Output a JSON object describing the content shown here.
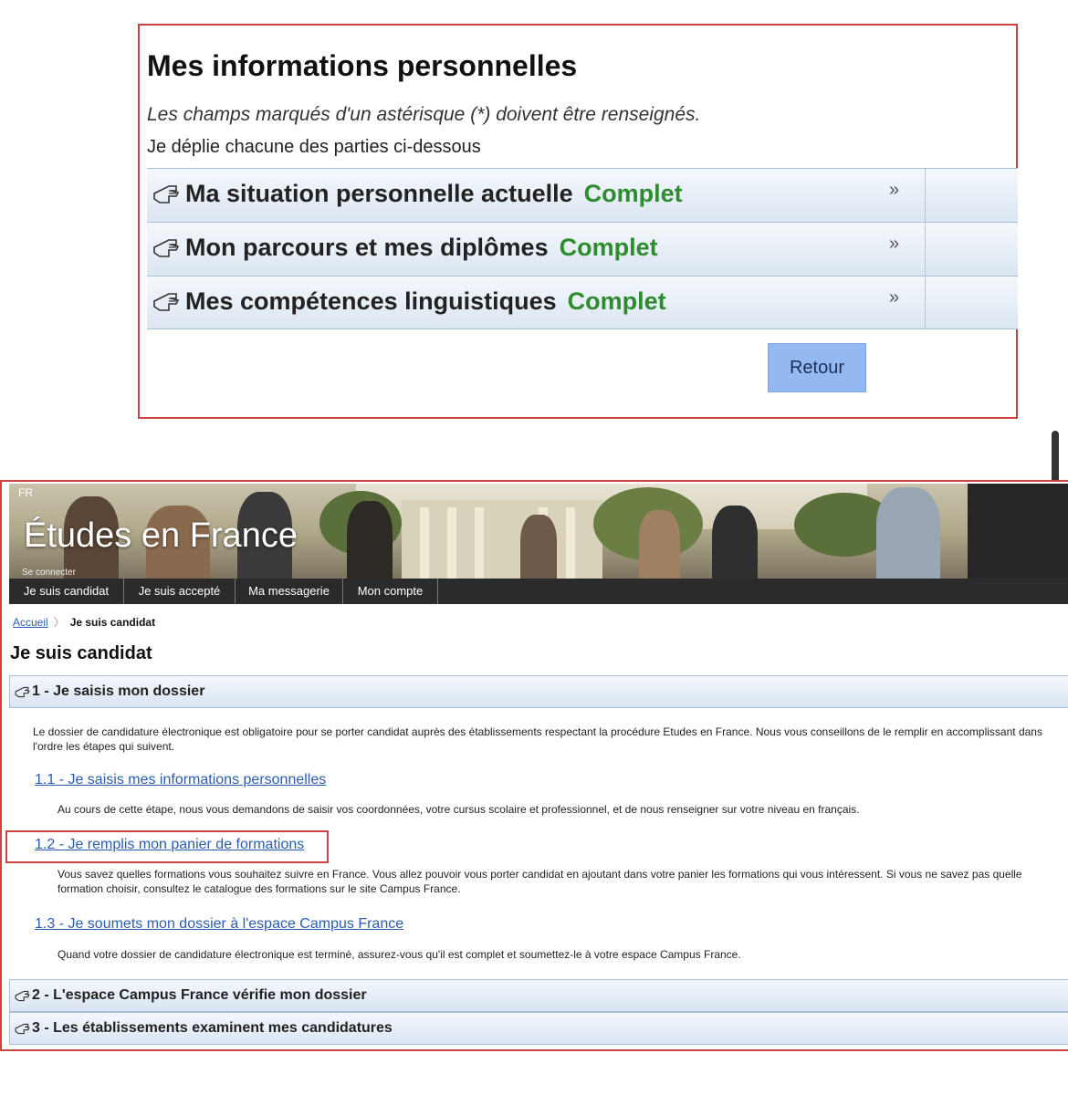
{
  "top_panel": {
    "title": "Mes informations personnelles",
    "note": "Les champs marqués d'un astérisque (*) doivent être renseignés.",
    "instruction": "Je déplie chacune des parties ci-dessous",
    "sections": [
      {
        "label": "Ma situation personnelle actuelle",
        "status": "Complet",
        "chevron": "»"
      },
      {
        "label": "Mon parcours et mes diplômes",
        "status": "Complet",
        "chevron": "»"
      },
      {
        "label": "Mes compétences linguistiques",
        "status": "Complet",
        "chevron": "»"
      }
    ],
    "retour_label": "Retour"
  },
  "site": {
    "lang": "FR",
    "title": "Études en France",
    "banner_sub": "Se connecter"
  },
  "nav": {
    "items": [
      "Je suis candidat",
      "Je suis accepté",
      "Ma messagerie",
      "Mon compte"
    ]
  },
  "breadcrumb": {
    "home": "Accueil",
    "separator": "〉",
    "current": "Je suis candidat"
  },
  "page": {
    "title": "Je suis candidat",
    "step1": {
      "label": "1 - Je saisis mon dossier",
      "intro": "Le dossier de candidature électronique est obligatoire pour se porter candidat auprès des établissements respectant la procédure Etudes en France. Nous vous conseillons de le remplir en accomplissant dans l'ordre les étapes qui suivent.",
      "substeps": [
        {
          "link": "1.1 - Je saisis mes informations personnelles",
          "text": "Au cours de cette étape, nous vous demandons de saisir vos coordonnées, votre cursus scolaire et professionnel, et de nous renseigner sur votre niveau en français."
        },
        {
          "link": "1.2 - Je remplis mon panier de formations",
          "text": "Vous savez quelles formations vous souhaitez suivre en France. Vous allez pouvoir vous porter candidat en ajoutant dans votre panier les formations qui vous intéressent. Si vous ne savez pas quelle formation choisir, consultez le catalogue des formations sur le site Campus France."
        },
        {
          "link": "1.3 - Je soumets mon dossier à l'espace Campus France",
          "text": "Quand votre dossier de candidature électronique est terminé, assurez-vous qu'il est complet et soumettez-le à votre espace Campus France."
        }
      ]
    },
    "step2": {
      "label": "2 - L'espace Campus France vérifie mon dossier"
    },
    "step3": {
      "label": "3 - Les établissements examinent mes candidatures"
    }
  },
  "colors": {
    "accent_red": "#d04040",
    "status_green": "#2e8b2e",
    "link_blue": "#2a5db0",
    "button_blue": "#93b9f0",
    "nav_dark": "#2b2b2b"
  },
  "icons": {
    "section": "hand-pointer-icon",
    "expand": "double-chevron-icon"
  }
}
